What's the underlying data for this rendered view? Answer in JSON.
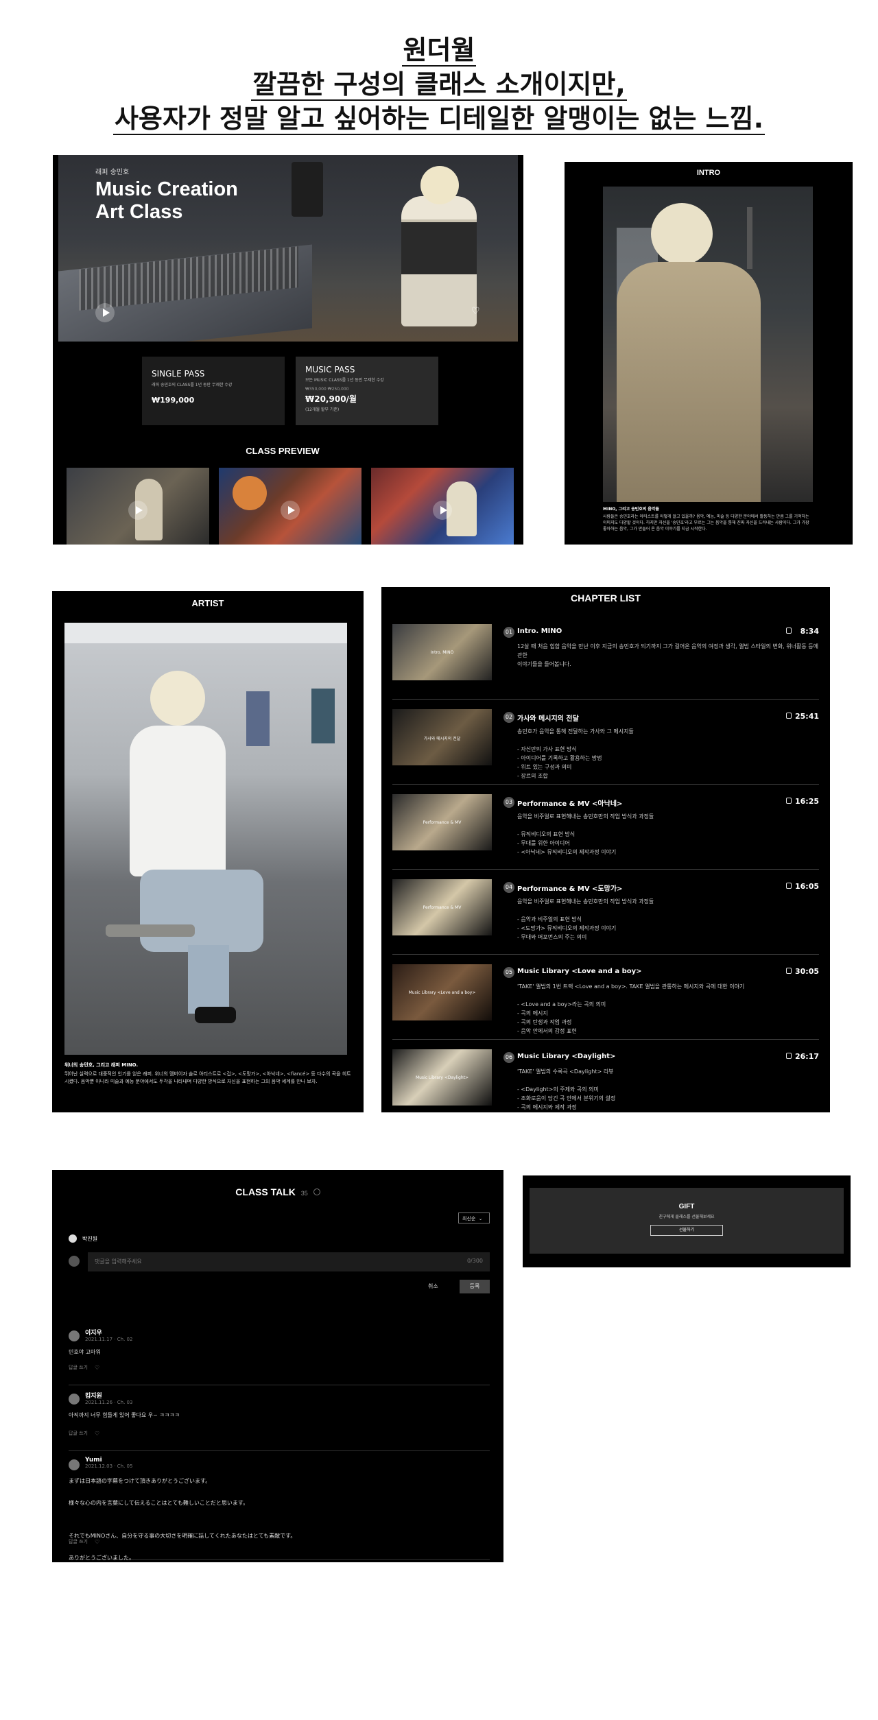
{
  "header": {
    "line1": "원더월",
    "line2": "깔끔한 구성의 클래스 소개이지만,",
    "line3": "사용자가 정말 알고 싶어하는 디테일한 알맹이는 없는 느낌."
  },
  "hero": {
    "eyebrow": "래퍼 송민호",
    "title_line1": "Music Creation",
    "title_line2": "Art Class",
    "passes": [
      {
        "name": "SINGLE PASS",
        "desc": "래퍼 송민호의 CLASS를 1년 동안 무제한 수강",
        "strike": "",
        "price": "₩199,000",
        "note": ""
      },
      {
        "name": "MUSIC PASS",
        "desc": "모든 MUSIC CLASS를 1년 동안 무제한 수강",
        "strike": "₩350,000 ₩250,000",
        "price": "₩20,900/월",
        "note": "(12개월 할부 기준)"
      }
    ],
    "preview_title": "CLASS PREVIEW"
  },
  "intro": {
    "title": "INTRO",
    "caption_title": "MINO, 그리고 송민호의 음악들",
    "caption": "사람들은 송민호라는 아티스트를 어떻게 알고 있을까? 음악, 예능, 미술 등 다양한 분야에서 활동하는 만큼 그를 기억하는 이미지도 다양할 것이다. 하지만 자신을 '송민호'라고 부르는 그는 음악을 통해 진짜 자신을 드러내는 사람이다. 그가 가장 좋아하는 음악, 그가 만들어 온 음악 이야기를 지금 시작한다."
  },
  "artist": {
    "title": "ARTIST",
    "caption_title": "위너의 송민호, 그리고 래퍼 MINO.",
    "caption": "뛰어난 실력으로 대중적인 인기를 얻은 래퍼. 위너의 멤버이자 솔로 아티스트로 <겁>, <도망가>, <아낙네>, <fiancé> 등 다수의 곡을 히트시켰다. 음악뿐 아니라 미술과 예능 분야에서도 두각을 나타내며 다양한 방식으로 자신을 표현하는 그의 음악 세계를 만나 보자."
  },
  "chapters": {
    "title": "CHAPTER LIST",
    "items": [
      {
        "num": "01",
        "title": "Intro. MINO",
        "time": "8:34",
        "thumb_label": "Intro. MINO",
        "desc": "12살 때 처음 힙합 음악을 만난 이후 지금의 송민호가 되기까지 그가 걸어온 음악의 여정과 생각, 앨범 스타일의 변화, 위너활동 등에 관한\n이야기들을 들어봅니다."
      },
      {
        "num": "02",
        "title": "가사와 메시지의 전달",
        "time": "25:41",
        "thumb_label": "가사와 메시지의 전달",
        "desc": "송민호가 음악을 통해 전달하는 가사와 그 메시지들\n\n- 자신만의 가사 표현 방식\n- 아이디어를 기록하고 활용하는 방법\n- 위트 있는 구성과 의미\n- 장르의 조합"
      },
      {
        "num": "03",
        "title": "Performance & MV <아낙네>",
        "time": "16:25",
        "thumb_label": "Performance & MV",
        "desc": "음악을 비주얼로 표현해내는 송민호만의 작업 방식과 과정들\n\n- 뮤직비디오의 표현 방식\n- 무대를 위한 아이디어\n- <아낙네> 뮤직비디오의 제작과정 이야기"
      },
      {
        "num": "04",
        "title": "Performance & MV <도망가>",
        "time": "16:05",
        "thumb_label": "Performance & MV",
        "desc": "음악을 비주얼로 표현해내는 송민호만의 작업 방식과 과정들\n\n- 음악과 비주얼의 표현 방식\n- <도망가> 뮤직비디오의 제작과정 이야기\n- 무대와 퍼포먼스의 주는 의미"
      },
      {
        "num": "05",
        "title": "Music Library <Love and a boy>",
        "time": "30:05",
        "thumb_label": "Music Library <Love and a boy>",
        "desc": "'TAKE' 앨범의 1번 트랙 <Love and a boy>. TAKE 앨범을 관통하는 메시지와 곡에 대한 이야기\n\n- <Love and a boy>라는 곡의 의미\n- 곡의 메시지\n- 곡의 탄생과 작업 과정\n- 음악 안에서의 감정 표현"
      },
      {
        "num": "06",
        "title": "Music Library <Daylight>",
        "time": "26:17",
        "thumb_label": "Music Library <Daylight>",
        "desc": "'TAKE' 앨범의 수록곡 <Daylight> 리뷰\n\n- <Daylight>의 주제와 곡의 의미\n- 조화로움이 담긴 곡 안에서 분위기의 설정\n- 곡의 메시지와 제작 과정"
      }
    ]
  },
  "talk": {
    "title": "CLASS TALK",
    "count": "35",
    "sort": "최신순",
    "user": "박진원",
    "placeholder": "댓글을 입력해주세요",
    "counter": "0/300",
    "cancel": "취소",
    "submit": "등록",
    "comments": [
      {
        "name": "이지우",
        "date": "2021.11.17 · Ch. 02",
        "text": "민호야 고마워",
        "reply": "답글 쓰기"
      },
      {
        "name": "킴지원",
        "date": "2021.11.26 · Ch. 03",
        "text": "아직까지 너무 힘들게 있어 좋다요 우~ ㅋㅋㅋㅋ",
        "reply": "답글 쓰기"
      },
      {
        "name": "Yumi",
        "date": "2021.12.03 · Ch. 05",
        "text": "まずは日本語の字幕をつけて頂きありがとうございます。\n\n様々な心の内を言葉にして伝えることはとても難しいことだと思います。\n\n\nそれでもMINOさん、自分を守る事の大切さを明確に話してくれたあなたはとても素敵です。\n\nありがとうございました。",
        "reply": "답글 쓰기"
      }
    ]
  },
  "gift": {
    "title": "GIFT",
    "desc": "친구에게 클래스를 선물해보세요",
    "button": "선물하기"
  },
  "colors": {
    "panel": "#000000",
    "card": "#1c1c1c",
    "text": "#ffffff",
    "muted": "#aaaaaa"
  }
}
